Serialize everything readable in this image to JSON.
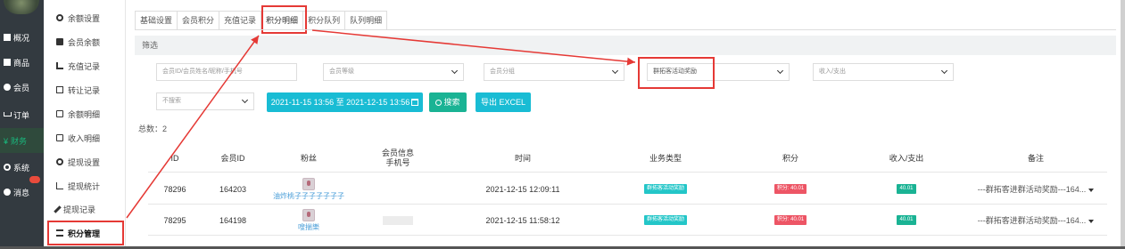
{
  "sidebar": {
    "items": [
      {
        "label": "概况",
        "icon": "box-icon"
      },
      {
        "label": "商品",
        "icon": "box-icon"
      },
      {
        "label": "会员",
        "icon": "users-icon"
      },
      {
        "label": "订单",
        "icon": "cart-icon"
      },
      {
        "label": "财务",
        "icon": "yen-icon",
        "prefix": "¥"
      },
      {
        "label": "系统",
        "icon": "gear-icon"
      },
      {
        "label": "消息",
        "icon": "chat-icon"
      }
    ]
  },
  "submenu": {
    "items": [
      {
        "label": "余额设置",
        "icon": "gear-icon"
      },
      {
        "label": "会员余额",
        "icon": "wallet-icon"
      },
      {
        "label": "充值记录",
        "icon": "download-icon"
      },
      {
        "label": "转让记录",
        "icon": "share-icon"
      },
      {
        "label": "余额明细",
        "icon": "document-icon"
      },
      {
        "label": "收入明细",
        "icon": "document-icon"
      },
      {
        "label": "提现设置",
        "icon": "gear-icon"
      },
      {
        "label": "提现统计",
        "icon": "chart-icon"
      },
      {
        "label": "提现记录",
        "icon": "pen-icon"
      },
      {
        "label": "积分管理",
        "icon": "list-icon"
      }
    ]
  },
  "tabs": [
    "基础设置",
    "会员积分",
    "充值记录",
    "积分明细",
    "积分队列",
    "队列明细"
  ],
  "filter": {
    "title": "筛选",
    "member_search_placeholder": "会员ID/会员姓名/昵称/手机号",
    "member_level": "会员等级",
    "member_group": "会员分组",
    "business_type": "群拓客活动奖励",
    "income_expense": "收入/支出",
    "search_scope": "不搜索",
    "date_range": "2021-11-15 13:56 至 2021-12-15 13:56",
    "search_button": "搜索",
    "export_button": "导出 EXCEL"
  },
  "total_label": "总数：2",
  "table": {
    "headers": [
      "ID",
      "会员ID",
      "粉丝",
      "会员信息\n手机号",
      "时间",
      "业务类型",
      "积分",
      "收入/支出",
      "备注"
    ],
    "rows": [
      {
        "id": "78296",
        "member_id": "164203",
        "fan": "油炸桃子子子子子子子",
        "phone": "",
        "time": "2021-12-15 12:09:11",
        "type": "群拓客活动奖励",
        "points": "积分: 40.01",
        "income": "40.01",
        "remark": "---群拓客进群活动奖励---164..."
      },
      {
        "id": "78295",
        "member_id": "164198",
        "fan": "嗖揣樂",
        "phone": "",
        "time": "2021-12-15 11:58:12",
        "type": "群拓客活动奖励",
        "points": "积分: 40.01",
        "income": "40.01",
        "remark": "---群拓客进群活动奖励---164..."
      }
    ]
  },
  "colors": {
    "sidebar_bg": "#333a40",
    "accent_teal": "#19bcd4",
    "accent_green": "#1ab394",
    "points_red": "#ed5565",
    "highlight_red": "#e53935"
  }
}
